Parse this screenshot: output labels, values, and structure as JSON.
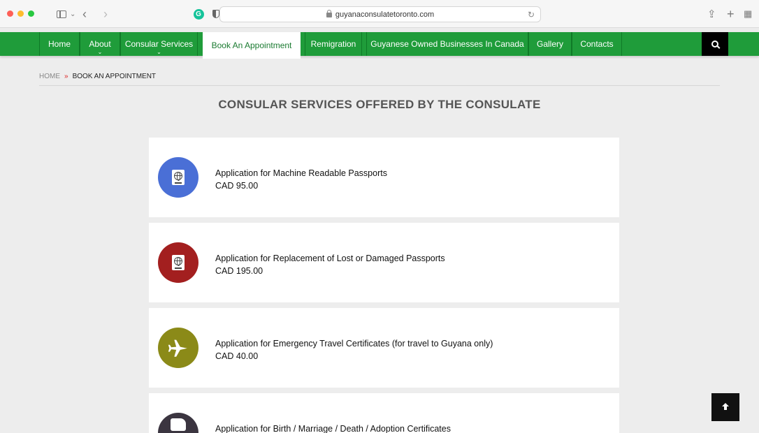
{
  "browser": {
    "url": "guyanaconsulatetoronto.com"
  },
  "nav": {
    "items": [
      {
        "label": "Home"
      },
      {
        "label": "About"
      },
      {
        "label": "Consular Services"
      },
      {
        "label": "Book An Appointment"
      },
      {
        "label": "Remigration"
      },
      {
        "label": "Guyanese Owned Businesses In Canada"
      },
      {
        "label": "Gallery"
      },
      {
        "label": "Contacts"
      }
    ],
    "active": "Book An Appointment"
  },
  "breadcrumb": {
    "home": "HOME",
    "separator": "»",
    "current": "BOOK AN APPOINTMENT"
  },
  "section_title": "CONSULAR SERVICES OFFERED BY THE CONSULATE",
  "services": [
    {
      "title": "Application for Machine Readable Passports",
      "price": "CAD 95.00",
      "icon": "passport-icon",
      "color": "#4a6fd6"
    },
    {
      "title": "Application for Replacement of Lost or Damaged Passports",
      "price": "CAD 195.00",
      "icon": "passport-icon",
      "color": "#a31f1f"
    },
    {
      "title": "Application for Emergency Travel Certificates (for travel to Guyana only)",
      "price": "CAD 40.00",
      "icon": "airplane-icon",
      "color": "#8b8a18"
    },
    {
      "title": "Application for Birth / Marriage / Death / Adoption Certificates",
      "price": "",
      "icon": "certificate-icon",
      "color": "#3b3540"
    }
  ],
  "colors": {
    "nav_green": "#1f9c3a",
    "breadcrumb_separator": "#dd2222"
  }
}
